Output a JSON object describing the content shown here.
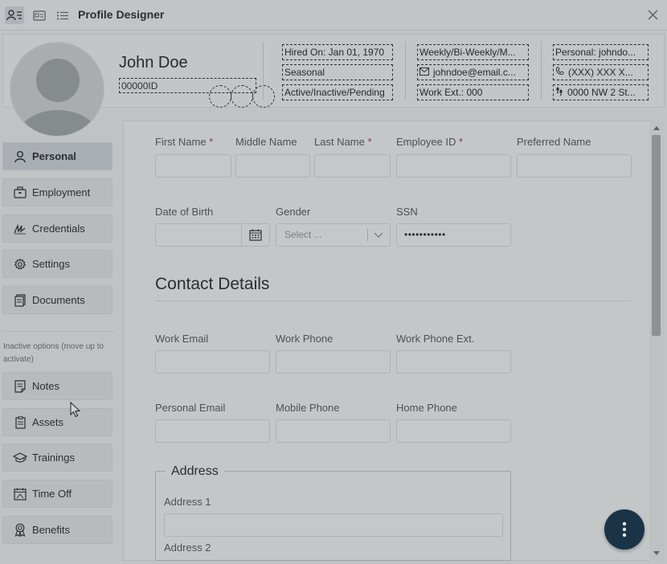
{
  "app": {
    "title": "Profile Designer",
    "icons": [
      "person-list-icon",
      "id-card-icon",
      "list-icon",
      "close-icon"
    ]
  },
  "header": {
    "name": "John Doe",
    "employee_id": "00000ID",
    "hired_on": "Hired On: Jan 01, 1970",
    "employment_type": "Seasonal",
    "status": "Active/Inactive/Pending",
    "pay_schedule": "Weekly/Bi-Weekly/M...",
    "work_email": "johndoe@email.c...",
    "work_ext": "Work Ext.: 000",
    "personal_email": "Personal: johndo...",
    "phone": "(XXX) XXX X...",
    "address": "0000 NW 2 St..."
  },
  "sidebar": {
    "active_items": [
      {
        "label": "Personal",
        "icon": "person-icon"
      },
      {
        "label": "Employment",
        "icon": "briefcase-icon"
      },
      {
        "label": "Credentials",
        "icon": "signature-icon"
      },
      {
        "label": "Settings",
        "icon": "gear-icon"
      },
      {
        "label": "Documents",
        "icon": "documents-icon"
      }
    ],
    "inactive_note": "Inactive options (move up to activate)",
    "inactive_items": [
      {
        "label": "Notes",
        "icon": "note-icon"
      },
      {
        "label": "Assets",
        "icon": "clipboard-icon"
      },
      {
        "label": "Trainings",
        "icon": "graduation-cap-icon"
      },
      {
        "label": "Time Off",
        "icon": "calendar-icon"
      },
      {
        "label": "Benefits",
        "icon": "award-icon"
      }
    ]
  },
  "form": {
    "first_name": "First Name",
    "middle_name": "Middle Name",
    "last_name": "Last Name",
    "employee_id": "Employee ID",
    "preferred_name": "Preferred Name",
    "required_mark": "*",
    "date_of_birth": "Date of Birth",
    "gender": "Gender",
    "gender_placeholder": "Select ...",
    "ssn": "SSN",
    "ssn_value": "•••••••••••",
    "contact_title": "Contact Details",
    "work_email": "Work Email",
    "work_phone": "Work Phone",
    "work_phone_ext": "Work Phone Ext.",
    "personal_email": "Personal Email",
    "mobile_phone": "Mobile Phone",
    "home_phone": "Home Phone",
    "address_legend": "Address",
    "address1": "Address 1",
    "address2": "Address 2"
  },
  "colors": {
    "accent": "#1b3346",
    "required": "#8a3b3b"
  }
}
